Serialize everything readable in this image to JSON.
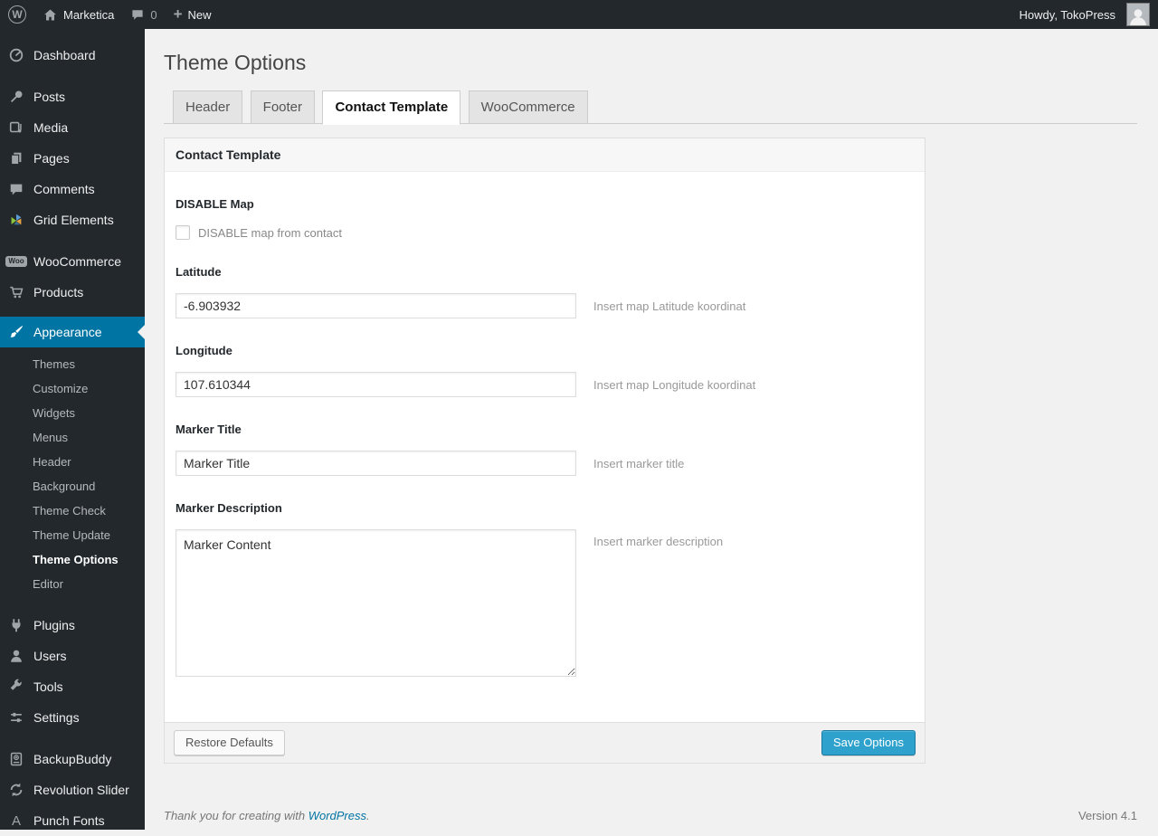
{
  "admin_bar": {
    "site_name": "Marketica",
    "comment_count": "0",
    "new_label": "New",
    "howdy": "Howdy, TokoPress"
  },
  "icons": {
    "wp_logo": "W",
    "new_plus": "+",
    "woo_badge": "Woo",
    "punch_fonts": "A"
  },
  "sidebar": {
    "items": [
      {
        "label": "Dashboard",
        "icon": "dashboard-icon"
      },
      {
        "label": "Posts",
        "icon": "pin-icon"
      },
      {
        "label": "Media",
        "icon": "media-icon"
      },
      {
        "label": "Pages",
        "icon": "pages-icon"
      },
      {
        "label": "Comments",
        "icon": "comment-icon"
      },
      {
        "label": "Grid Elements",
        "icon": "grid-elements-icon"
      },
      {
        "label": "WooCommerce",
        "icon": "woocommerce-icon"
      },
      {
        "label": "Products",
        "icon": "cart-icon"
      },
      {
        "label": "Appearance",
        "icon": "brush-icon",
        "active": true
      },
      {
        "label": "Plugins",
        "icon": "plug-icon"
      },
      {
        "label": "Users",
        "icon": "user-icon"
      },
      {
        "label": "Tools",
        "icon": "wrench-icon"
      },
      {
        "label": "Settings",
        "icon": "settings-icon"
      },
      {
        "label": "BackupBuddy",
        "icon": "backup-drive-icon"
      },
      {
        "label": "Revolution Slider",
        "icon": "refresh-icon"
      },
      {
        "label": "Punch Fonts",
        "icon": "letter-a-icon"
      }
    ],
    "appearance_submenu": [
      {
        "label": "Themes"
      },
      {
        "label": "Customize"
      },
      {
        "label": "Widgets"
      },
      {
        "label": "Menus"
      },
      {
        "label": "Header"
      },
      {
        "label": "Background"
      },
      {
        "label": "Theme Check"
      },
      {
        "label": "Theme Update"
      },
      {
        "label": "Theme Options",
        "current": true
      },
      {
        "label": "Editor"
      }
    ]
  },
  "page": {
    "title": "Theme Options",
    "tabs": [
      {
        "label": "Header",
        "active": false
      },
      {
        "label": "Footer",
        "active": false
      },
      {
        "label": "Contact Template",
        "active": true
      },
      {
        "label": "WooCommerce",
        "active": false
      }
    ],
    "panel": {
      "title": "Contact Template",
      "fields": {
        "disable_map": {
          "label": "DISABLE Map",
          "checkbox_label": "DISABLE map from contact",
          "checked": false
        },
        "latitude": {
          "label": "Latitude",
          "value": "-6.903932",
          "help": "Insert map Latitude koordinat"
        },
        "longitude": {
          "label": "Longitude",
          "value": "107.610344",
          "help": "Insert map Longitude koordinat"
        },
        "marker_title": {
          "label": "Marker Title",
          "value": "Marker Title",
          "help": "Insert marker title"
        },
        "marker_description": {
          "label": "Marker Description",
          "value": "Marker Content",
          "help": "Insert marker description"
        }
      },
      "buttons": {
        "restore": "Restore Defaults",
        "save": "Save Options"
      }
    },
    "footer": {
      "thanks_prefix": "Thank you for creating with ",
      "link_text": "WordPress",
      "thanks_suffix": ".",
      "version": "Version 4.1"
    }
  },
  "colors": {
    "admin_bar_bg": "#23282d",
    "sidebar_bg": "#23282d",
    "active_menu_bg": "#0074a2",
    "content_bg": "#f1f1f1",
    "primary_button_bg": "#2ea2cc",
    "link": "#0074a2"
  }
}
